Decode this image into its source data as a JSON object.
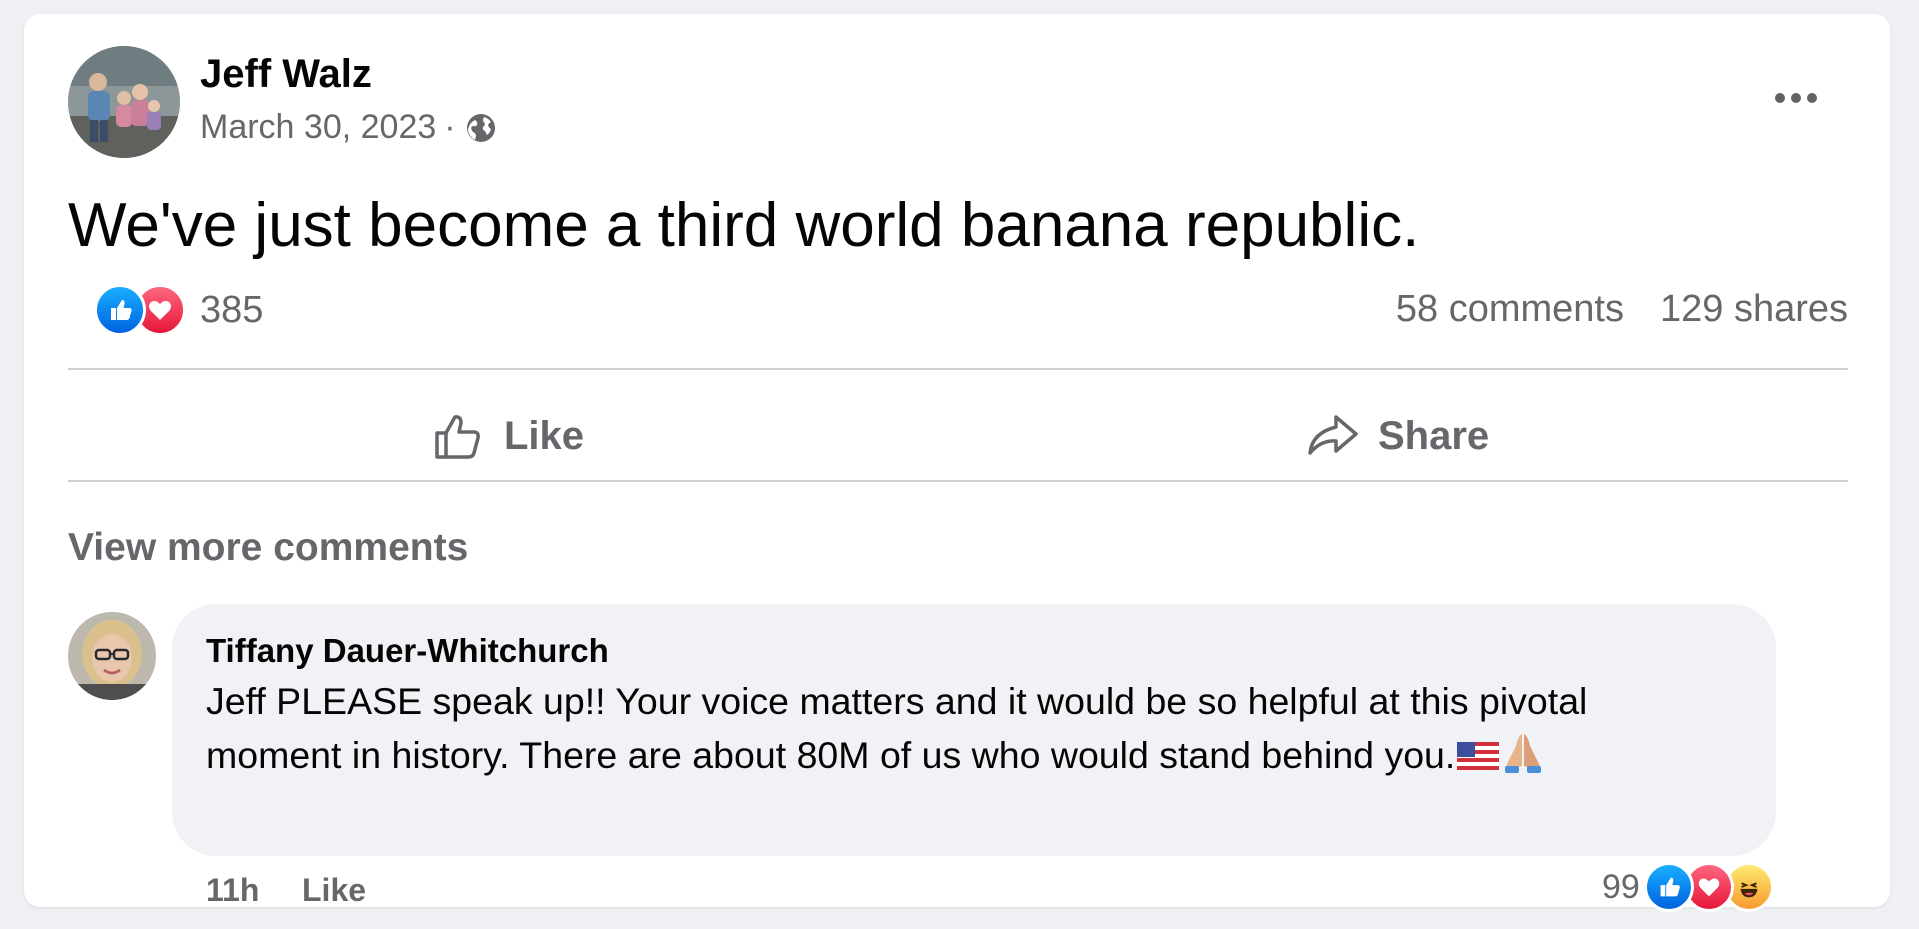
{
  "post": {
    "author": "Jeff Walz",
    "date": "March 30, 2023",
    "separator": "·",
    "text": "We've just become a third world banana republic.",
    "reaction_count": "385",
    "comments": "58 comments",
    "shares": "129 shares"
  },
  "actions": {
    "like": "Like",
    "share": "Share"
  },
  "comments_section": {
    "view_more": "View more comments",
    "comment": {
      "author": "Tiffany Dauer-Whitchurch",
      "text": "Jeff PLEASE speak up!! Your voice matters and it would be so helpful at this pivotal moment in history. There are about 80M of us who would stand behind you.",
      "time": "11h",
      "like": "Like",
      "reaction_count": "99"
    }
  },
  "colors": {
    "background": "#eef0f3",
    "card": "#ffffff",
    "secondary_text": "#65676b",
    "primary_text": "#050505",
    "like_blue": "#0062df",
    "love_red": "#e61739",
    "bubble": "#f0f2f5"
  },
  "icons": {
    "audience": "globe-icon",
    "menu": "more-horizontal-icon",
    "like": "thumbs-up-icon",
    "share": "share-arrow-icon",
    "reactions": [
      "like-reaction-icon",
      "love-reaction-icon",
      "haha-reaction-icon"
    ],
    "comment_emojis": [
      "us-flag-emoji",
      "folded-hands-emoji"
    ]
  }
}
